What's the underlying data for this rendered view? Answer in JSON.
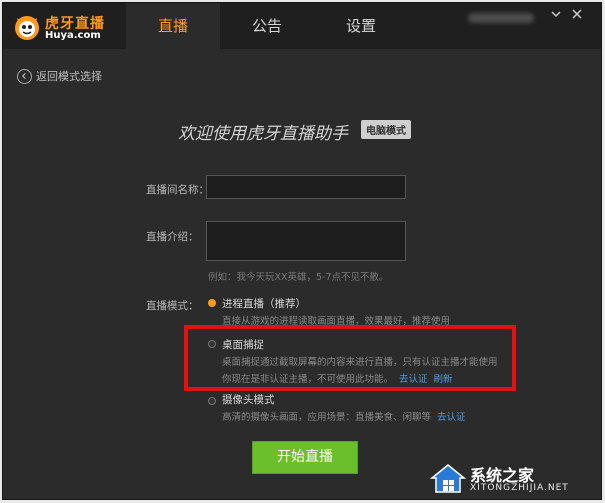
{
  "app": {
    "brand_cn": "虎牙直播",
    "brand_en": "Huya.com"
  },
  "nav": {
    "tabs": [
      {
        "label": "直播"
      },
      {
        "label": "公告"
      },
      {
        "label": "设置"
      }
    ]
  },
  "back": {
    "label": "返回模式选择"
  },
  "welcome": {
    "title": "欢迎使用虎牙直播助手",
    "mode": "电脑模式"
  },
  "form": {
    "room_name_label": "直播间名称：",
    "room_name_value": "",
    "intro_label": "直播介绍：",
    "intro_value": "",
    "intro_hint": "例如：我今天玩XX英雄，5-7点不见不散。",
    "mode_label": "直播模式："
  },
  "options": [
    {
      "title": "进程直播（推荐）",
      "desc": "直接从游戏的进程读取画面直播，效果最好，推荐使用",
      "checked": true
    },
    {
      "title": "桌面捕捉",
      "desc": "桌面捕捉通过截取屏幕的内容来进行直播，只有认证主播才能使用",
      "desc2": "你现在是非认证主播，不可使用此功能。",
      "link1": "去认证",
      "link2": "刷新",
      "checked": false
    },
    {
      "title": "摄像头模式",
      "desc": "高清的摄像头画面，应用场景：直播美食、闲聊等",
      "link1": "去认证",
      "checked": false
    }
  ],
  "start_button": {
    "label": "开始直播"
  },
  "watermark": {
    "cn": "系统之家",
    "en": "XITONGZHIJIA.NET"
  },
  "colors": {
    "accent": "#ff9c1e",
    "start": "#6cbf2c",
    "highlight": "#e01212",
    "link": "#4d9be0"
  }
}
